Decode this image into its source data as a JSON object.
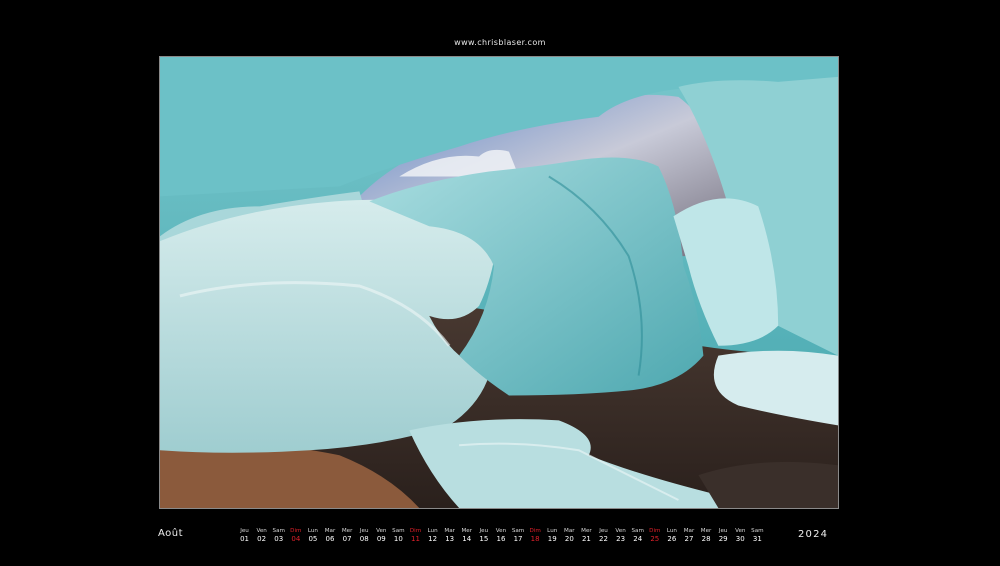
{
  "website": "www.chrisblaser.com",
  "month": "Août",
  "year": "2024",
  "accent_sunday_color": "#e0202a",
  "photo": {
    "alt_subject": "glacier-ice-image"
  },
  "days": [
    {
      "w": "Jeu",
      "n": "01",
      "sun": false
    },
    {
      "w": "Ven",
      "n": "02",
      "sun": false
    },
    {
      "w": "Sam",
      "n": "03",
      "sun": false
    },
    {
      "w": "Dim",
      "n": "04",
      "sun": true
    },
    {
      "w": "Lun",
      "n": "05",
      "sun": false
    },
    {
      "w": "Mar",
      "n": "06",
      "sun": false
    },
    {
      "w": "Mer",
      "n": "07",
      "sun": false
    },
    {
      "w": "Jeu",
      "n": "08",
      "sun": false
    },
    {
      "w": "Ven",
      "n": "09",
      "sun": false
    },
    {
      "w": "Sam",
      "n": "10",
      "sun": false
    },
    {
      "w": "Dim",
      "n": "11",
      "sun": true
    },
    {
      "w": "Lun",
      "n": "12",
      "sun": false
    },
    {
      "w": "Mar",
      "n": "13",
      "sun": false
    },
    {
      "w": "Mer",
      "n": "14",
      "sun": false
    },
    {
      "w": "Jeu",
      "n": "15",
      "sun": false
    },
    {
      "w": "Ven",
      "n": "16",
      "sun": false
    },
    {
      "w": "Sam",
      "n": "17",
      "sun": false
    },
    {
      "w": "Dim",
      "n": "18",
      "sun": true
    },
    {
      "w": "Lun",
      "n": "19",
      "sun": false
    },
    {
      "w": "Mar",
      "n": "20",
      "sun": false
    },
    {
      "w": "Mer",
      "n": "21",
      "sun": false
    },
    {
      "w": "Jeu",
      "n": "22",
      "sun": false
    },
    {
      "w": "Ven",
      "n": "23",
      "sun": false
    },
    {
      "w": "Sam",
      "n": "24",
      "sun": false
    },
    {
      "w": "Dim",
      "n": "25",
      "sun": true
    },
    {
      "w": "Lun",
      "n": "26",
      "sun": false
    },
    {
      "w": "Mar",
      "n": "27",
      "sun": false
    },
    {
      "w": "Mer",
      "n": "28",
      "sun": false
    },
    {
      "w": "Jeu",
      "n": "29",
      "sun": false
    },
    {
      "w": "Ven",
      "n": "30",
      "sun": false
    },
    {
      "w": "Sam",
      "n": "31",
      "sun": false
    }
  ]
}
